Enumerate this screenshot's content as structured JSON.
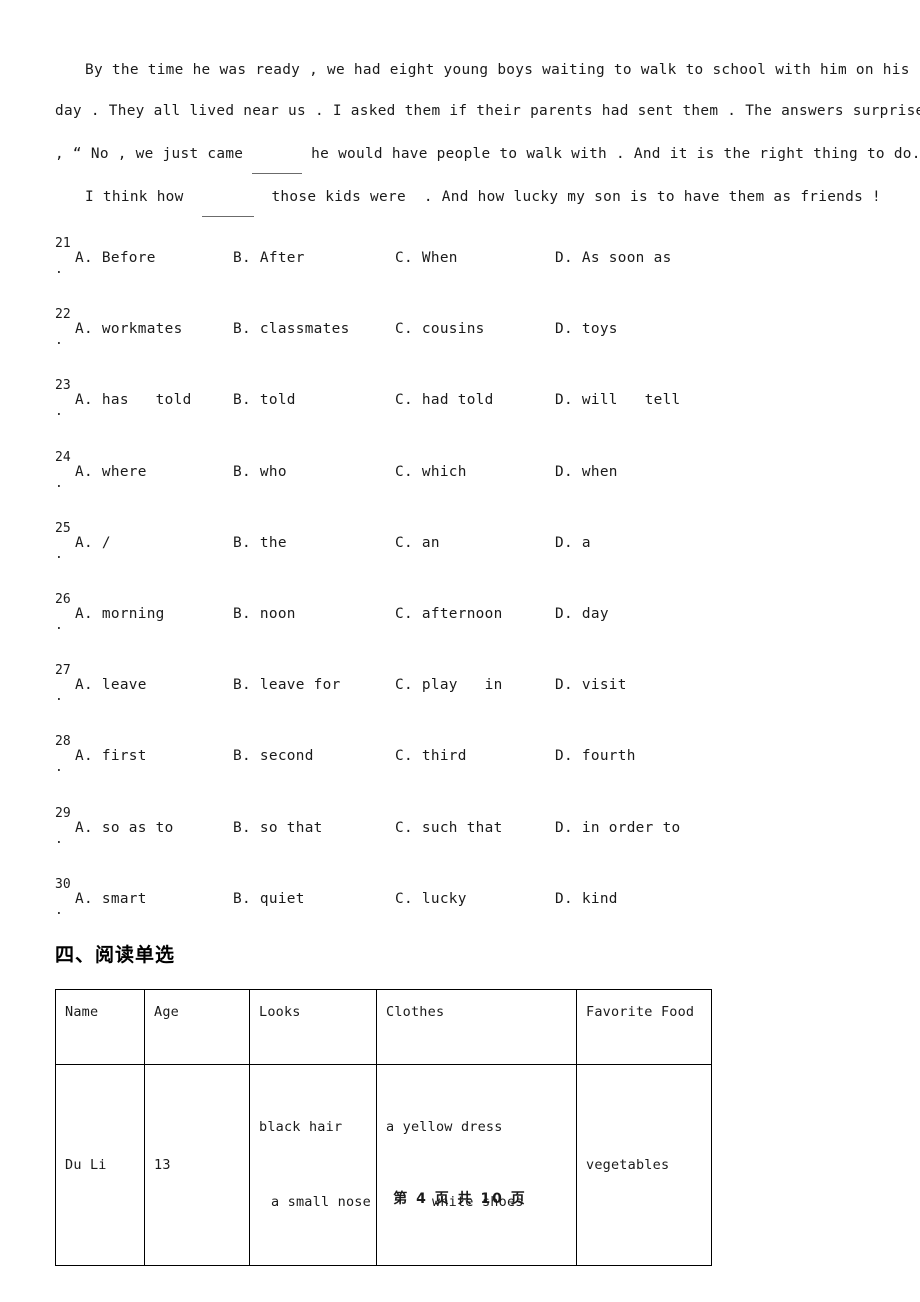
{
  "passage": {
    "lines": [
      {
        "indent": true,
        "parts": [
          {
            "t": "text",
            "v": "By the time he was ready , we had eight young boys waiting to walk to school with him on his  "
          },
          {
            "t": "blank",
            "size": "b1"
          }
        ]
      },
      {
        "indent": false,
        "parts": [
          {
            "t": "text",
            "v": "day . They all lived near us . I asked them if their parents had sent them . The answers surprised me"
          }
        ]
      },
      {
        "indent": false,
        "parts": [
          {
            "t": "text",
            "v": ", “ No , we just came "
          },
          {
            "t": "blank",
            "size": "b2"
          },
          {
            "t": "text",
            "v": " he would have people to walk with . And it is the right thing to do.   “"
          }
        ]
      },
      {
        "indent": false,
        "parts": [
          {
            "t": "text",
            "v": ""
          }
        ]
      },
      {
        "indent": true,
        "parts": [
          {
            "t": "text",
            "v": "I think how  "
          },
          {
            "t": "blank",
            "size": "b3"
          },
          {
            "t": "text",
            "v": "  those kids were  . And how lucky my son is to have them as friends !"
          }
        ]
      }
    ]
  },
  "questions": [
    {
      "number": "21",
      "dot": ".",
      "options": [
        "A. Before",
        "B. After",
        "C. When",
        "D. As soon as"
      ]
    },
    {
      "number": "22",
      "dot": ".",
      "options": [
        "A. workmates",
        "B. classmates",
        "C. cousins",
        "D. toys"
      ]
    },
    {
      "number": "23",
      "dot": ".",
      "options": [
        "A. has   told",
        "B. told",
        "C. had told",
        "D. will   tell"
      ]
    },
    {
      "number": "24",
      "dot": ".",
      "options": [
        "A. where",
        "B. who",
        "C. which",
        "D. when"
      ]
    },
    {
      "number": "25",
      "dot": ".",
      "options": [
        "A. /",
        "B. the",
        "C. an",
        "D. a"
      ]
    },
    {
      "number": "26",
      "dot": ".",
      "options": [
        "A. morning",
        "B. noon",
        "C. afternoon",
        "D. day"
      ]
    },
    {
      "number": "27",
      "dot": ".",
      "options": [
        "A. leave",
        "B. leave for",
        "C. play   in",
        "D. visit"
      ]
    },
    {
      "number": "28",
      "dot": ".",
      "options": [
        "A. first",
        "B. second",
        "C. third",
        "D. fourth"
      ]
    },
    {
      "number": "29",
      "dot": ".",
      "options": [
        "A. so as to",
        "B. so that",
        "C. such that",
        "D. in order to"
      ]
    },
    {
      "number": "30",
      "dot": ".",
      "options": [
        "A. smart",
        "B. quiet",
        "C. lucky",
        "D. kind"
      ]
    }
  ],
  "section_heading": "四、阅读单选",
  "table": {
    "headers": [
      "Name",
      "Age",
      "Looks",
      "Clothes",
      "Favorite Food"
    ],
    "row": {
      "name": "Du Li",
      "age": "13",
      "looks_line1": "black hair",
      "looks_line2": "a small nose",
      "clothes_line1": "a yellow dress",
      "clothes_line2": "white shoes",
      "food": "vegetables"
    }
  },
  "footer": {
    "text": "第 4 页 共 10 页"
  }
}
